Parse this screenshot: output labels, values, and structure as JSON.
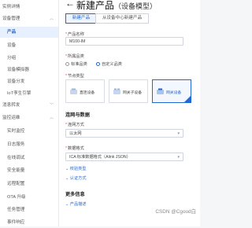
{
  "sidebar": {
    "items": [
      {
        "label": "实例详情",
        "level": "top"
      },
      {
        "label": "设备管理",
        "level": "top",
        "chevron": "^"
      },
      {
        "label": "产品",
        "level": "sub",
        "active": true
      },
      {
        "label": "设备",
        "level": "sub"
      },
      {
        "label": "分组",
        "level": "sub"
      },
      {
        "label": "设备模拟器",
        "level": "sub"
      },
      {
        "label": "设备分发",
        "level": "sub"
      },
      {
        "label": "IoT孪生引擎",
        "level": "sub"
      },
      {
        "label": "消息转发",
        "level": "top",
        "chevron": "v"
      },
      {
        "label": "监控运维",
        "level": "top",
        "chevron": "^"
      },
      {
        "label": "实时监控",
        "level": "sub"
      },
      {
        "label": "日志服务",
        "level": "sub"
      },
      {
        "label": "在线调试",
        "level": "sub"
      },
      {
        "label": "安全能量",
        "level": "sub"
      },
      {
        "label": "远程配置",
        "level": "sub"
      },
      {
        "label": "OTA 升级",
        "level": "sub"
      },
      {
        "label": "任务管理",
        "level": "sub"
      },
      {
        "label": "事件响应",
        "level": "sub"
      }
    ]
  },
  "header": {
    "back_icon": "arrow-left-icon",
    "title": "新建产品",
    "subtitle": "（设备模型）"
  },
  "tabs": [
    {
      "label": "新建产品",
      "active": true
    },
    {
      "label": "从设备中心新建产品",
      "active": false
    }
  ],
  "form": {
    "product_name": {
      "label": "产品名称",
      "value": "M100-IM"
    },
    "category": {
      "label": "所属品类",
      "options": [
        {
          "label": "标准品类",
          "checked": false
        },
        {
          "label": "自定义品类",
          "checked": true
        }
      ]
    },
    "node_type": {
      "label": "节点类型",
      "options": [
        {
          "label": "直连设备",
          "selected": false
        },
        {
          "label": "网关子设备",
          "selected": false
        },
        {
          "label": "网关设备",
          "selected": true
        }
      ]
    },
    "network_section_title": "连网与数据",
    "network_method": {
      "label": "连网方式",
      "value": "以太网"
    },
    "data_format": {
      "label": "数据格式",
      "value": "ICA 标准数据格式（Alink JSON）"
    },
    "link_verify_type": "校验类型",
    "link_auth_method": "认证方式",
    "more_section_title": "更多信息",
    "link_product_desc": "产品描述"
  },
  "watermark": "CSDN @Cgood白",
  "colors": {
    "accent": "#1f68d6",
    "required": "#e34d4d"
  }
}
